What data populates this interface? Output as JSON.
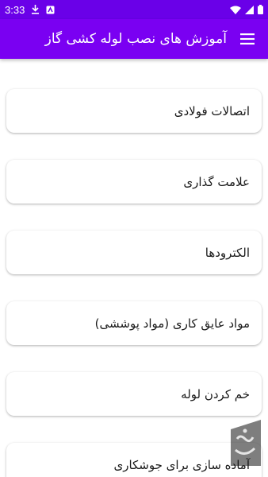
{
  "status_bar": {
    "time": "3:33",
    "left_icons": [
      "download-icon",
      "app-notification-icon"
    ],
    "right_icons": [
      "wifi-icon",
      "cellular-signal-icon",
      "battery-icon"
    ]
  },
  "app_bar": {
    "title": "آموزش های نصب لوله کشی گاز",
    "menu_icon": "hamburger-menu-icon",
    "background": "#7a00f2"
  },
  "items": [
    {
      "label": "اتصالات فولادی"
    },
    {
      "label": "علامت گذاری"
    },
    {
      "label": "الکترودها"
    },
    {
      "label": "مواد عایق کاری (مواد پوششی)"
    },
    {
      "label": "خم کردن لوله"
    },
    {
      "label": "آماده سازی برای جوشکاری"
    }
  ],
  "colors": {
    "status_bar": "#6a00e8",
    "app_bar": "#7a00f2",
    "card_text": "#1a1a1a"
  }
}
